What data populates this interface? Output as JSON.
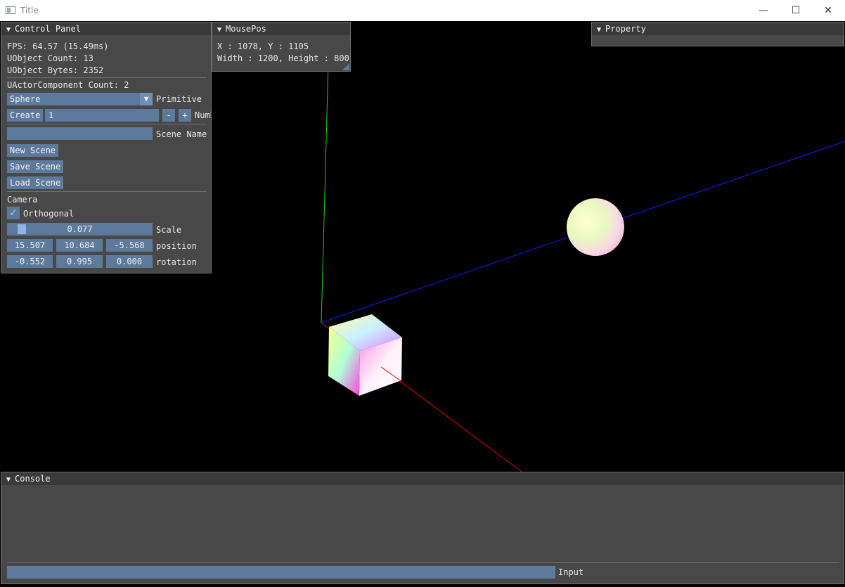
{
  "window": {
    "title": "Title",
    "minimize": "—",
    "maximize": "☐",
    "close": "✕"
  },
  "control_panel": {
    "header": "Control Panel",
    "fps": "FPS: 64.57 (15.49ms)",
    "uobject_count": "UObject Count: 13",
    "uobject_bytes": "UObject Bytes: 2352",
    "actor_component_count": "UActorComponent Count: 2",
    "primitive_value": "Sphere",
    "primitive_label": "Primitive",
    "create_button": "Create",
    "number_value": "1",
    "minus_button": "-",
    "plus_button": "+",
    "number_label": "Number",
    "scene_name_value": "",
    "scene_name_label": "Scene Name",
    "new_scene_button": "New Scene",
    "save_scene_button": "Save Scene",
    "load_scene_button": "Load Scene",
    "camera_heading": "Camera",
    "orthogonal_label": "Orthogonal",
    "orthogonal_checked": true,
    "scale_value": "0.077",
    "scale_label": "Scale",
    "position": [
      "15.507",
      "10.684",
      "-5.568"
    ],
    "position_label": "position",
    "rotation": [
      "-0.552",
      "0.995",
      "0.000"
    ],
    "rotation_label": "rotation"
  },
  "mouse_pos": {
    "header": "MousePos",
    "xy": "X : 1078, Y : 1105",
    "size": "Width : 1200, Height : 800"
  },
  "property": {
    "header": "Property"
  },
  "console": {
    "header": "Console",
    "input_label": "Input",
    "input_value": ""
  },
  "icons": {
    "collapse": "▼",
    "checkmark": "✓",
    "dropdown": "▼"
  },
  "colors": {
    "accent": "#5d7a9c",
    "panel_bg": "#484848",
    "header_bg": "#3a3a3a"
  }
}
